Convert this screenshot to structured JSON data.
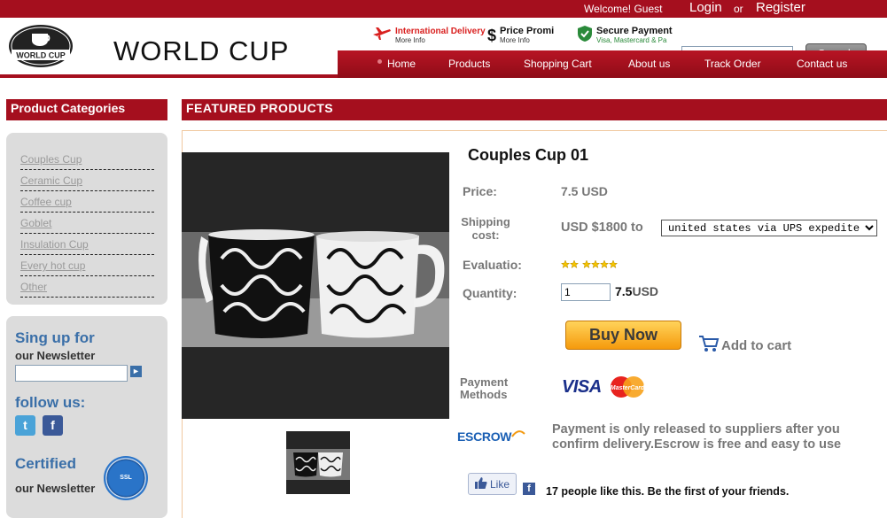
{
  "topbar": {
    "welcome": "Welcome! Guest",
    "login": "Login",
    "or": "or",
    "register": "Register"
  },
  "header": {
    "logo_text": "WORLD CUP",
    "brand": "WORLD CUP",
    "badges": {
      "intl_main": "International Delivery",
      "intl_sub": "More Info",
      "price_main": "Price Promi",
      "price_sub": "More Info",
      "secure_main": "Secure Payment",
      "secure_sub": "Visa, Mastercard & Pa"
    },
    "search_value": "",
    "search_button": "Search"
  },
  "nav": {
    "items": [
      "Home",
      "Products",
      "Shopping Cart",
      "About us",
      "Track Order",
      "Contact us"
    ]
  },
  "sidebar": {
    "title": "Product Categories",
    "categories": [
      "Couples Cup",
      "Ceramic Cup",
      "Coffee cup",
      "Goblet",
      "Insulation Cup",
      "Every hot cup",
      "Other"
    ],
    "newsletter_heading": "Sing up for",
    "newsletter_sub": "our Newsletter",
    "follow": "follow us:",
    "certified": "Certified",
    "certified_sub": "our Newsletter"
  },
  "main": {
    "title": "FEATURED  PRODUCTS",
    "product": {
      "name": "Couples Cup 01",
      "price_label": "Price:",
      "price": "7.5 USD",
      "shipping_label_1": "Shipping",
      "shipping_label_2": "cost:",
      "shipping_cost": "USD $1800 to",
      "shipping_option": "united states via UPS expedited",
      "evaluation_label": "Evaluatio:",
      "quantity_label": "Quantity:",
      "quantity": "1",
      "total_number": "7.5",
      "total_unit": "USD",
      "buy_now": "Buy Now",
      "add_to_cart": "Add to cart",
      "payment_label_1": "Payment",
      "payment_label_2": "Methods",
      "visa": "VISA",
      "mastercard": "MasterCard",
      "escrow": "ESCROW",
      "escrow_text": "Payment is only released to suppliers after you confirm delivery.Escrow is free and easy to use",
      "like_button": "Like",
      "like_text": "17 people like this. Be the first of your friends."
    }
  },
  "colors": {
    "brand_red": "#a50f1e",
    "link_blue": "#3a6fa8",
    "buy_orange": "#f59a0c"
  }
}
